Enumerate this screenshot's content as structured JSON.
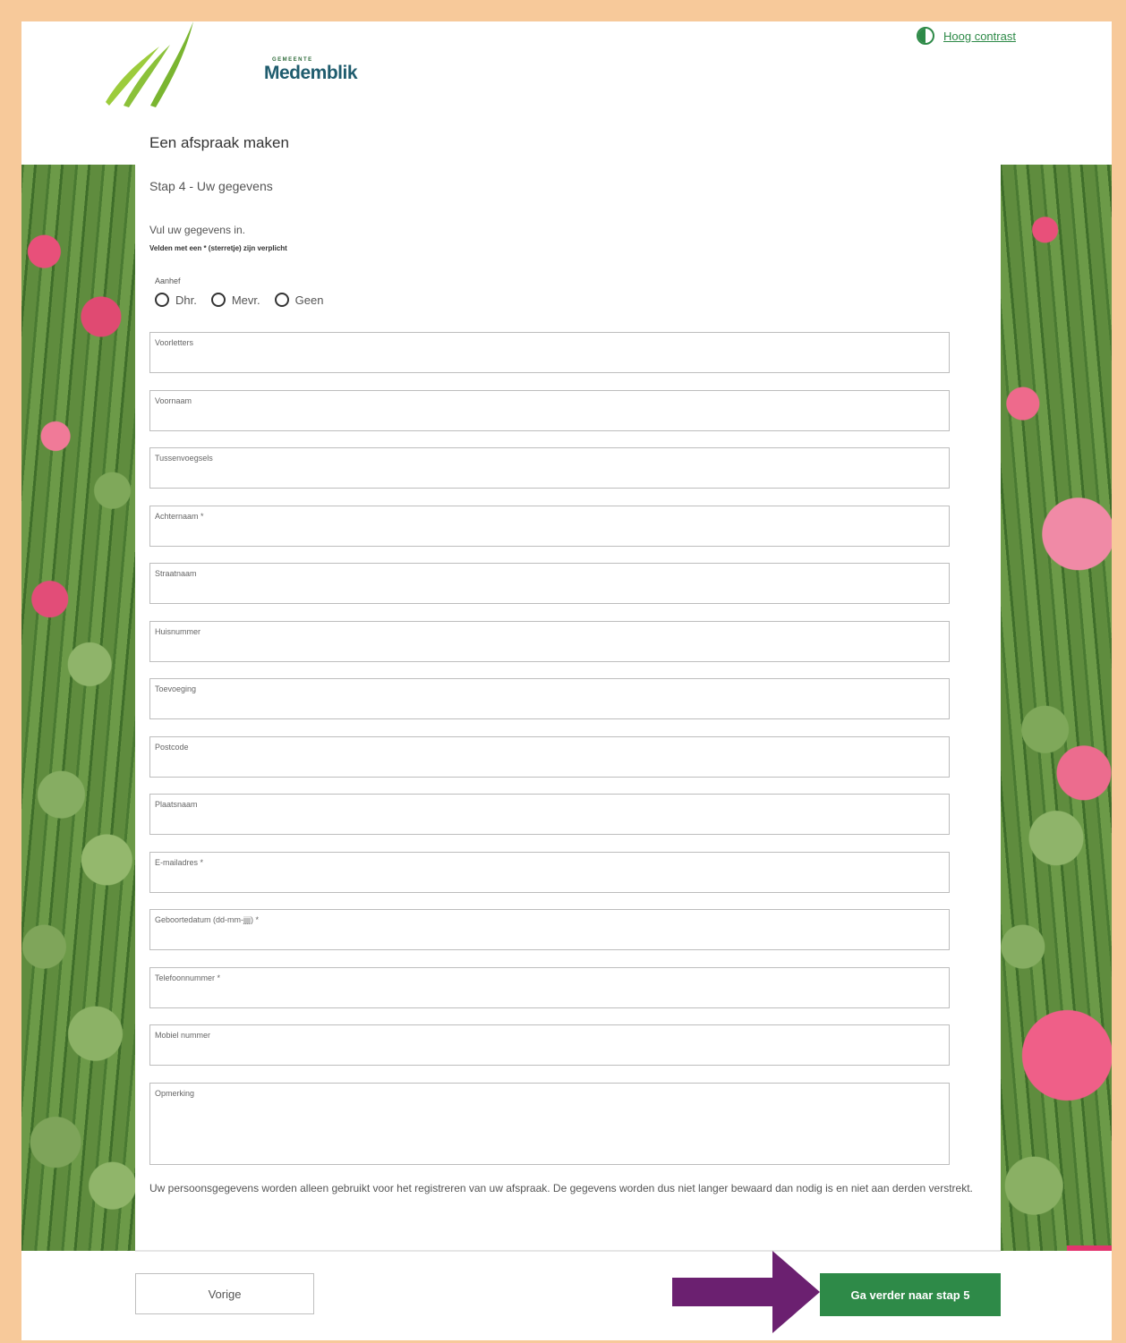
{
  "header": {
    "logo_small": "GEMEENTE",
    "logo_name": "Medemblik",
    "contrast_link": "Hoog contrast"
  },
  "page": {
    "title": "Een afspraak maken",
    "step": "Stap 4 - Uw gegevens",
    "intro": "Vul uw gegevens in.",
    "required_note": "Velden met een * (sterretje) zijn verplicht"
  },
  "aanhef": {
    "label": "Aanhef",
    "options": [
      "Dhr.",
      "Mevr.",
      "Geen"
    ]
  },
  "fields": [
    {
      "label": "Voorletters",
      "value": ""
    },
    {
      "label": "Voornaam",
      "value": ""
    },
    {
      "label": "Tussenvoegsels",
      "value": ""
    },
    {
      "label": "Achternaam *",
      "value": ""
    },
    {
      "label": "Straatnaam",
      "value": ""
    },
    {
      "label": "Huisnummer",
      "value": ""
    },
    {
      "label": "Toevoeging",
      "value": ""
    },
    {
      "label": "Postcode",
      "value": ""
    },
    {
      "label": "Plaatsnaam",
      "value": ""
    },
    {
      "label": "E-mailadres *",
      "value": ""
    },
    {
      "label": "Geboortedatum (dd-mm-jjjj) *",
      "value": ""
    },
    {
      "label": "Telefoonnummer *",
      "value": ""
    },
    {
      "label": "Mobiel nummer",
      "value": ""
    },
    {
      "label": "Opmerking",
      "value": ""
    }
  ],
  "privacy_text": "Uw persoonsgegevens worden alleen gebruikt voor het registreren van uw afspraak. De gegevens worden dus niet langer bewaard dan nodig is en niet aan derden verstrekt.",
  "footer": {
    "prev_label": "Vorige",
    "next_label": "Ga verder naar stap 5"
  },
  "colors": {
    "accent": "#2e8a48",
    "frame": "#f7c99a",
    "arrow": "#6b2070"
  }
}
